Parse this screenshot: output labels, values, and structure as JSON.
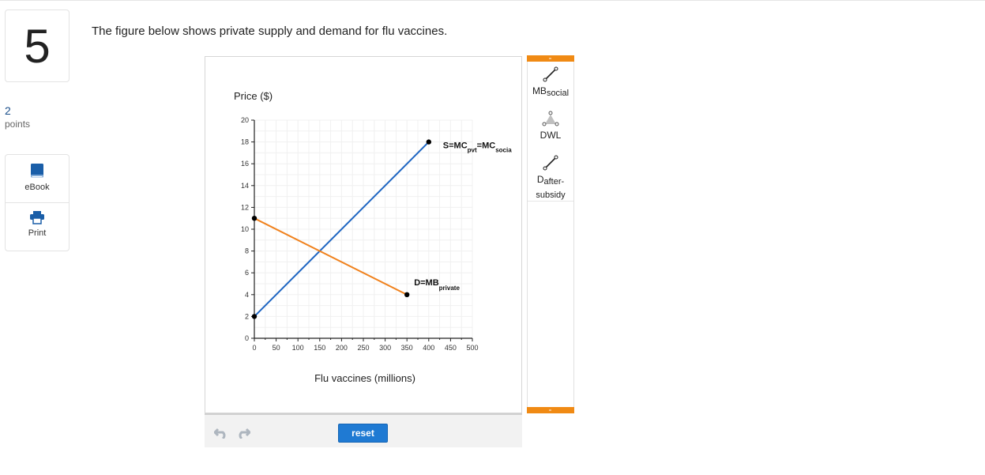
{
  "question": {
    "number": "5",
    "points_value": "2",
    "points_label": "points",
    "text": "The figure below shows private supply and demand for flu vaccines."
  },
  "sidebar": {
    "items": [
      {
        "label": "eBook",
        "icon": "book-icon"
      },
      {
        "label": "Print",
        "icon": "printer-icon"
      }
    ]
  },
  "graph": {
    "reset_label": "reset"
  },
  "palette": {
    "items": [
      {
        "label_main": "MB",
        "label_sub": "social",
        "icon": "line-tool-icon"
      },
      {
        "label_main": "DWL",
        "label_sub": "",
        "icon": "polygon-tool-icon"
      },
      {
        "label_main": "D",
        "label_sub": "after-subsidy",
        "icon": "line-tool-icon"
      }
    ]
  },
  "colors": {
    "supply": "#1f66c2",
    "demand": "#f0821e",
    "accent": "#f08a14",
    "button": "#1f7ad3"
  },
  "chart_data": {
    "type": "line",
    "xlabel": "Flu vaccines (millions)",
    "ylabel": "Price ($)",
    "xlim": [
      0,
      500
    ],
    "ylim": [
      0,
      20
    ],
    "xticks": [
      0,
      50,
      100,
      150,
      200,
      250,
      300,
      350,
      400,
      450,
      500
    ],
    "yticks": [
      0,
      2,
      4,
      6,
      8,
      10,
      12,
      14,
      16,
      18,
      20
    ],
    "grid": true,
    "series": [
      {
        "name": "S=MC",
        "sub1": "pvt",
        "mid": "=MC",
        "sub2": "socia",
        "points": [
          [
            0,
            2
          ],
          [
            400,
            18
          ]
        ],
        "color": "#1f66c2"
      },
      {
        "name": "D=MB",
        "sub1": "private",
        "points": [
          [
            0,
            11
          ],
          [
            350,
            4
          ]
        ],
        "color": "#f0821e"
      }
    ]
  }
}
